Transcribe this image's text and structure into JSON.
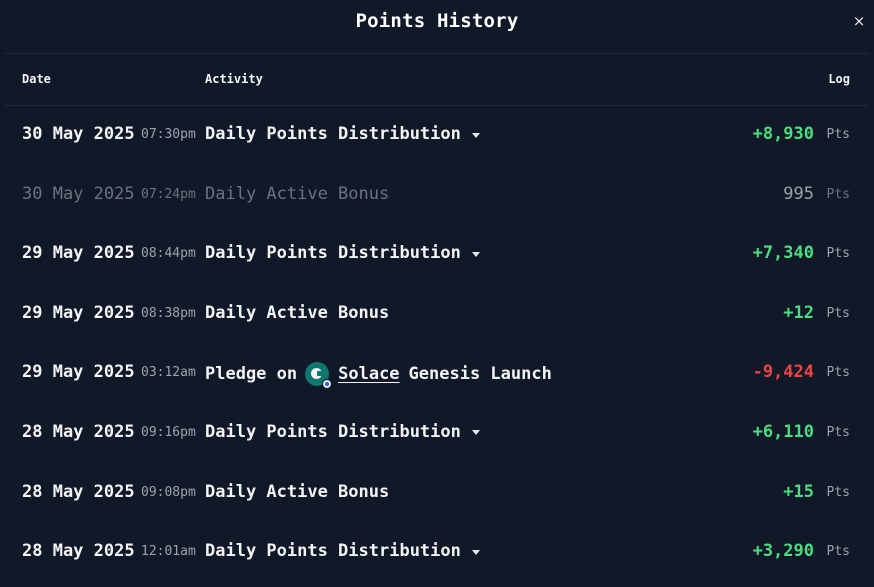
{
  "modal": {
    "title": "Points History",
    "close_icon": "×"
  },
  "table": {
    "headers": {
      "date": "Date",
      "activity": "Activity",
      "log": "Log"
    },
    "rows": [
      {
        "date": "30 May 2025",
        "time": "07:30pm",
        "activity": "Daily Points Distribution",
        "expandable": true,
        "amount": "+8,930",
        "unit": "Pts",
        "tone": "positive",
        "dim": false
      },
      {
        "date": "30 May 2025",
        "time": "07:24pm",
        "activity": "Daily Active Bonus",
        "expandable": false,
        "amount": "995",
        "unit": "Pts",
        "tone": "neutral",
        "dim": true
      },
      {
        "date": "29 May 2025",
        "time": "08:44pm",
        "activity": "Daily Points Distribution",
        "expandable": true,
        "amount": "+7,340",
        "unit": "Pts",
        "tone": "positive",
        "dim": false
      },
      {
        "date": "29 May 2025",
        "time": "08:38pm",
        "activity": "Daily Active Bonus",
        "expandable": false,
        "amount": "+12",
        "unit": "Pts",
        "tone": "positive",
        "dim": false
      },
      {
        "date": "29 May 2025",
        "time": "03:12am",
        "activity_prefix": "Pledge on",
        "project_name": "Solace",
        "activity_suffix": "Genesis Launch",
        "project_icon": "solace-logo-icon",
        "amount": "-9,424",
        "unit": "Pts",
        "tone": "negative",
        "dim": false
      },
      {
        "date": "28 May 2025",
        "time": "09:16pm",
        "activity": "Daily Points Distribution",
        "expandable": true,
        "amount": "+6,110",
        "unit": "Pts",
        "tone": "positive",
        "dim": false
      },
      {
        "date": "28 May 2025",
        "time": "09:08pm",
        "activity": "Daily Active Bonus",
        "expandable": false,
        "amount": "+15",
        "unit": "Pts",
        "tone": "positive",
        "dim": false
      },
      {
        "date": "28 May 2025",
        "time": "12:01am",
        "activity": "Daily Points Distribution",
        "expandable": true,
        "amount": "+3,290",
        "unit": "Pts",
        "tone": "positive",
        "dim": false
      }
    ]
  },
  "colors": {
    "background": "#111827",
    "positive": "#4ade80",
    "negative": "#ef4444",
    "muted": "#9ca3af",
    "divider": "#1f2937"
  }
}
